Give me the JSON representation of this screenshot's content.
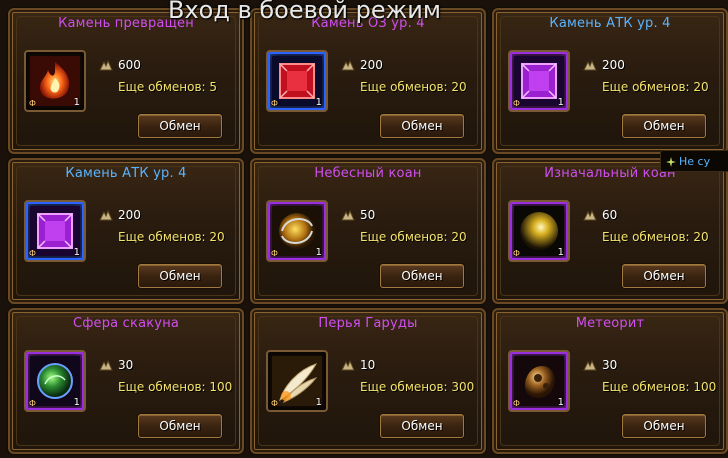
{
  "overlay_title": "Вход в боевой режим",
  "tooltip_text": "Не су",
  "button_label": "Обмен",
  "exchanges_prefix": "Еще обменов:",
  "cards": [
    {
      "title": "Камень превращен",
      "title_color": "pink",
      "cost": "600",
      "remaining": "5",
      "qty": "1",
      "icon": "fire-stone-icon"
    },
    {
      "title": "Камень ОЗ ур. 4",
      "title_color": "pink",
      "cost": "200",
      "remaining": "20",
      "qty": "1",
      "icon": "hp-stone-icon"
    },
    {
      "title": "Камень АТК ур. 4",
      "title_color": "blue",
      "cost": "200",
      "remaining": "20",
      "qty": "1",
      "icon": "atk-stone-icon"
    },
    {
      "title": "Камень АТК ур. 4",
      "title_color": "blue",
      "cost": "200",
      "remaining": "20",
      "qty": "1",
      "icon": "atk-stone-icon"
    },
    {
      "title": "Небесный коан",
      "title_color": "pink",
      "cost": "50",
      "remaining": "20",
      "qty": "1",
      "icon": "heavenly-koan-icon"
    },
    {
      "title": "Изначальный коан",
      "title_color": "pink",
      "cost": "60",
      "remaining": "20",
      "qty": "1",
      "icon": "primordial-koan-icon"
    },
    {
      "title": "Сфера скакуна",
      "title_color": "pink",
      "cost": "30",
      "remaining": "100",
      "qty": "1",
      "icon": "steed-sphere-icon"
    },
    {
      "title": "Перья Гаруды",
      "title_color": "pink",
      "cost": "10",
      "remaining": "300",
      "qty": "1",
      "icon": "garuda-feathers-icon"
    },
    {
      "title": "Метеорит",
      "title_color": "pink",
      "cost": "30",
      "remaining": "100",
      "qty": "1",
      "icon": "meteorite-icon"
    }
  ]
}
